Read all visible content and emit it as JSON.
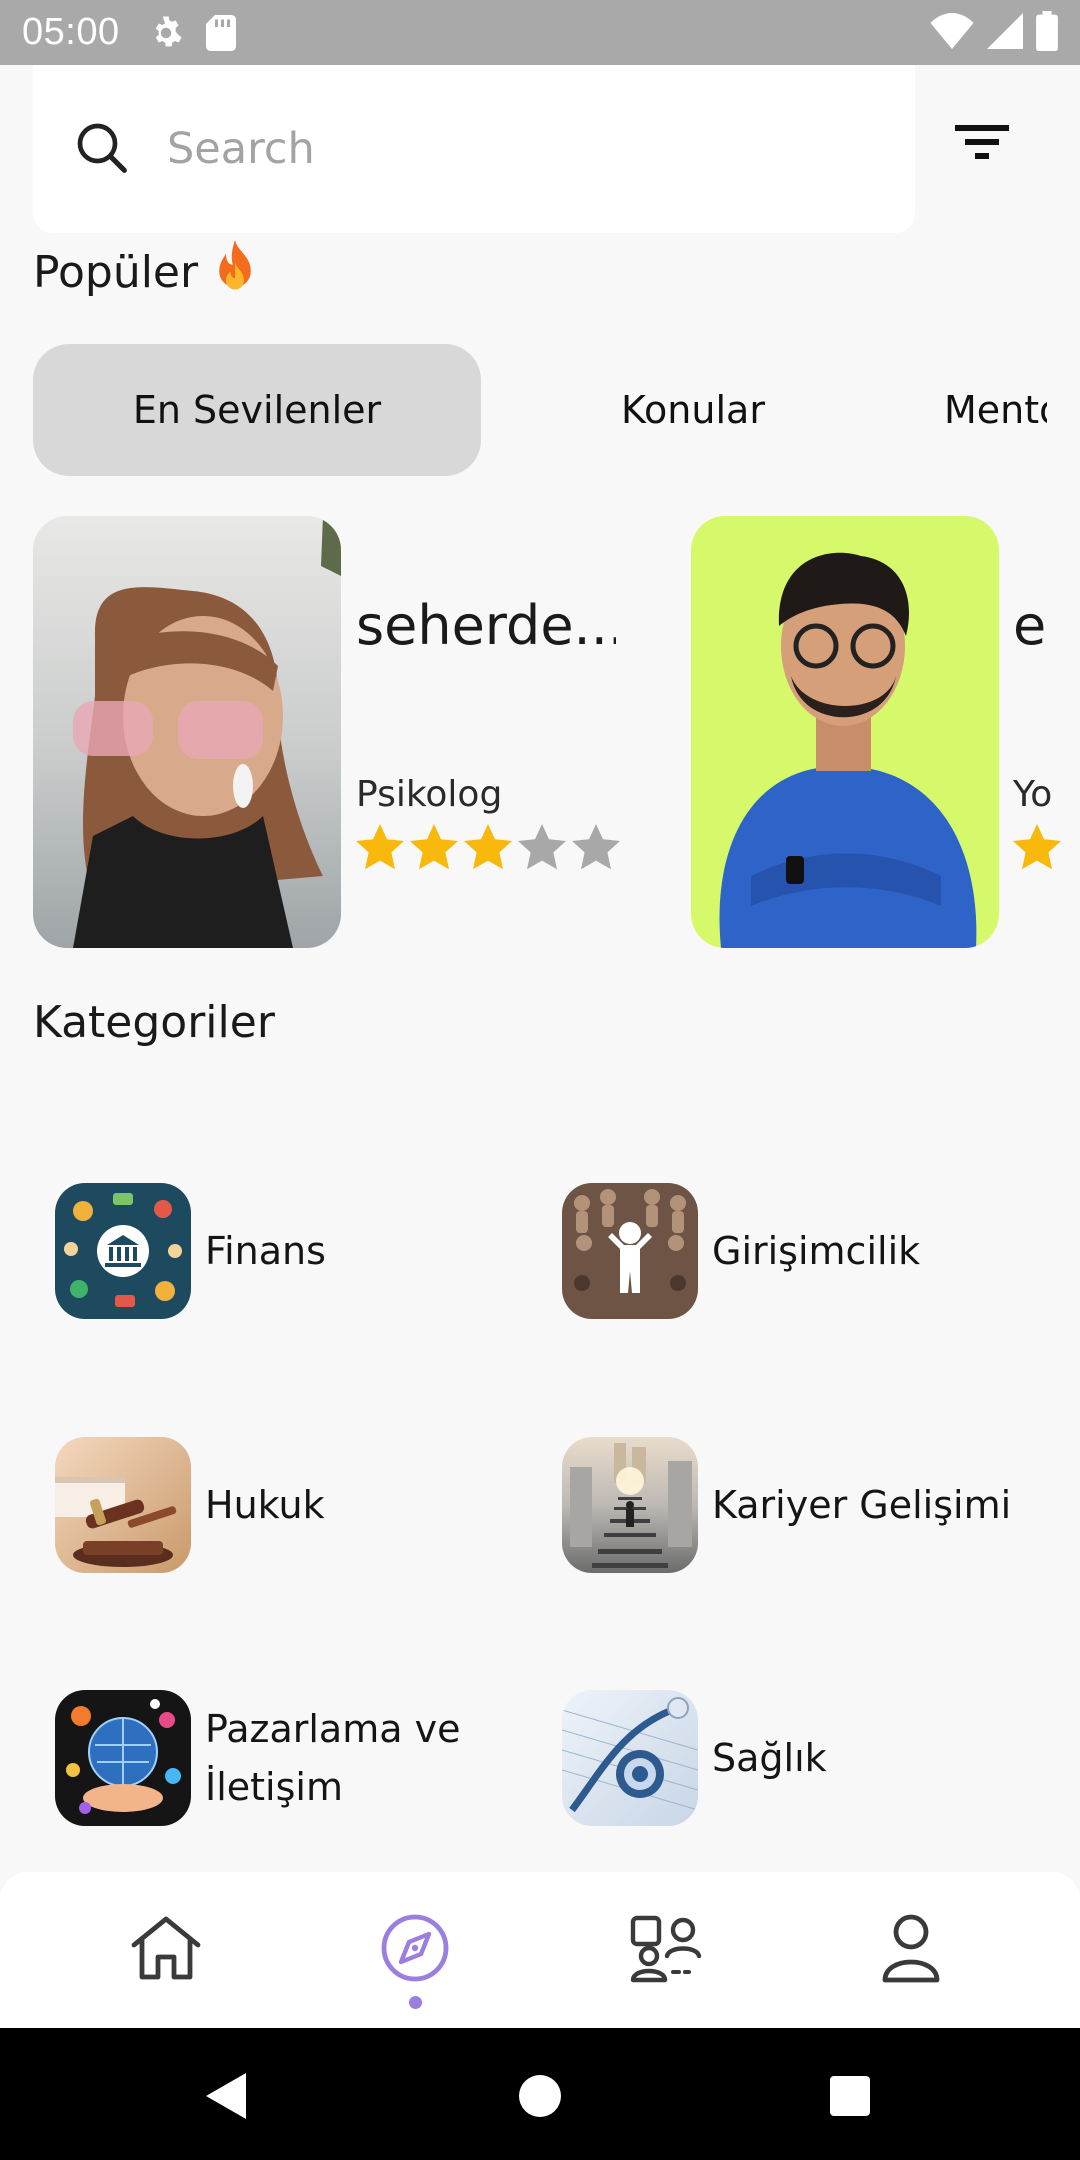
{
  "status_bar": {
    "time": "05:00",
    "icons": [
      "settings-icon",
      "sd-card-icon",
      "wifi-icon",
      "signal-icon",
      "battery-icon"
    ]
  },
  "search": {
    "placeholder": "Search"
  },
  "popular": {
    "title": "Popüler",
    "emoji": "🔥"
  },
  "tabs": [
    {
      "label": "En Sevilenler",
      "active": true
    },
    {
      "label": "Konular",
      "active": false
    },
    {
      "label": "Mentorlar",
      "active": false
    }
  ],
  "mentors": [
    {
      "name": "seherde...",
      "role": "Psikolog",
      "rating": 3,
      "max_rating": 5,
      "photo_bg": "#c9c9c9"
    },
    {
      "name": "e",
      "role": "Yo",
      "rating": 1,
      "max_rating": 5,
      "photo_bg": "#d6f86b"
    }
  ],
  "categories": {
    "title": "Kategoriler",
    "items": [
      {
        "label": "Finans",
        "icon": "finance-icon"
      },
      {
        "label": "Girişimcilik",
        "icon": "entrepreneurship-icon"
      },
      {
        "label": "Hukuk",
        "icon": "law-gavel-icon"
      },
      {
        "label": "Kariyer Gelişimi",
        "icon": "career-stairs-icon"
      },
      {
        "label_line1": "Pazarlama ve",
        "label_line2": "İletişim",
        "icon": "marketing-icon"
      },
      {
        "label": "Sağlık",
        "icon": "health-stethoscope-icon"
      }
    ]
  },
  "bottom_nav": {
    "items": [
      "home-icon",
      "explore-compass-icon",
      "mentors-group-icon",
      "profile-icon"
    ],
    "active": "explore-compass-icon"
  },
  "colors": {
    "accent": "#9b7fe0",
    "star_filled": "#f8b90c",
    "star_empty": "#a8a8a8",
    "tab_active_bg": "#d8d8d8"
  }
}
